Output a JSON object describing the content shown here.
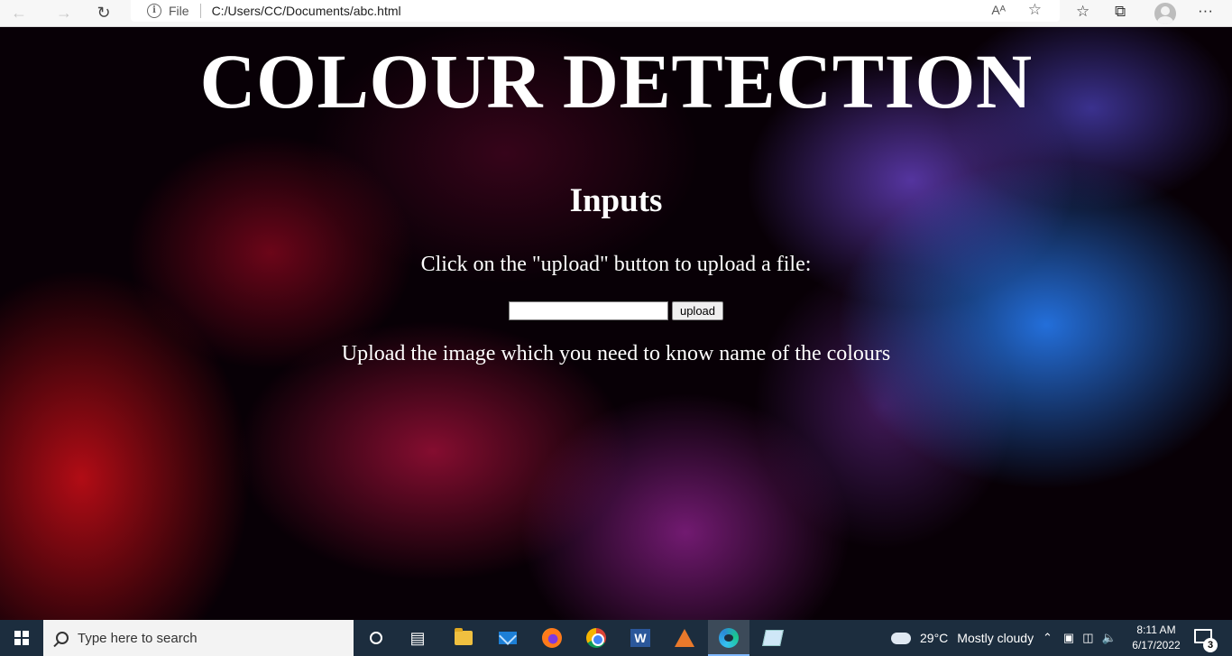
{
  "browser": {
    "back_icon": "arrow-left-icon",
    "forward_icon": "arrow-right-icon",
    "refresh_icon": "refresh-icon",
    "info_glyph": "i",
    "protocol_label": "File",
    "url": "C:/Users/CC/Documents/abc.html",
    "read_aloud_glyph": "Aᴬ",
    "more_glyph": "···"
  },
  "page": {
    "title": "COLOUR DETECTION",
    "section_heading": "Inputs",
    "instruction": "Click on the \"upload\" button to upload a file:",
    "file_input_value": "",
    "upload_label": "upload",
    "description": "Upload the image which you need to know name of the colours"
  },
  "taskbar": {
    "search_placeholder": "Type here to search",
    "word_glyph": "W",
    "weather_temp": "29°C",
    "weather_desc": "Mostly cloudy",
    "time": "8:11 AM",
    "date": "6/17/2022",
    "notification_count": "3"
  },
  "colors": {
    "title_text": "#ffffff",
    "taskbar_bg": "#1c2d3e",
    "accent": "#7fb8ff"
  }
}
